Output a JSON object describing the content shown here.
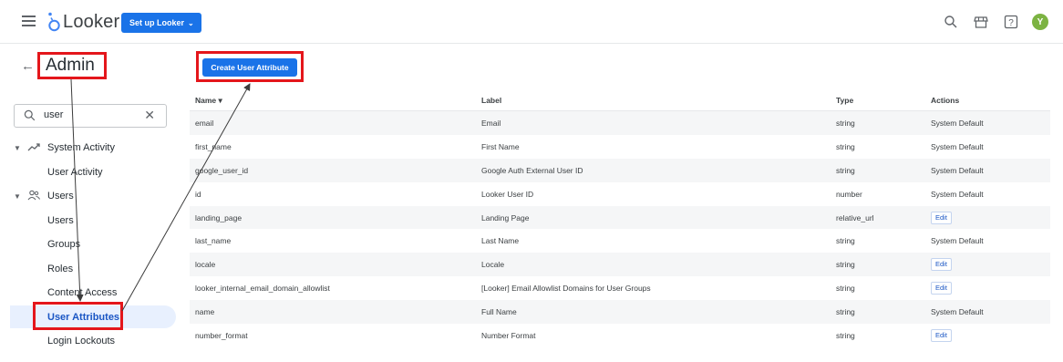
{
  "header": {
    "logo_text": "Looker",
    "setup_button_label": "Set up Looker",
    "avatar_initial": "Y",
    "icons": [
      "menu-icon",
      "search-icon",
      "marketplace-icon",
      "help-icon"
    ]
  },
  "sidebar": {
    "title": "Admin",
    "search": {
      "value": "user"
    },
    "groups": [
      {
        "label": "System Activity",
        "icon": "trend-icon",
        "items": [
          "User Activity"
        ]
      },
      {
        "label": "Users",
        "icon": "people-icon",
        "items": [
          "Users",
          "Groups",
          "Roles",
          "Content Access",
          "User Attributes",
          "Login Lockouts"
        ]
      }
    ],
    "active_item": "User Attributes"
  },
  "main": {
    "create_button_label": "Create User Attribute",
    "table": {
      "headers": [
        "Name",
        "Label",
        "Type",
        "Actions"
      ],
      "sorted_by": "Name",
      "rows": [
        {
          "name": "email",
          "label": "Email",
          "type": "string",
          "action": "System Default"
        },
        {
          "name": "first_name",
          "label": "First Name",
          "type": "string",
          "action": "System Default"
        },
        {
          "name": "google_user_id",
          "label": "Google Auth External User ID",
          "type": "string",
          "action": "System Default"
        },
        {
          "name": "id",
          "label": "Looker User ID",
          "type": "number",
          "action": "System Default"
        },
        {
          "name": "landing_page",
          "label": "Landing Page",
          "type": "relative_url",
          "action": "Edit"
        },
        {
          "name": "last_name",
          "label": "Last Name",
          "type": "string",
          "action": "System Default"
        },
        {
          "name": "locale",
          "label": "Locale",
          "type": "string",
          "action": "Edit"
        },
        {
          "name": "looker_internal_email_domain_allowlist",
          "label": "[Looker] Email Allowlist Domains for User Groups",
          "type": "string",
          "action": "Edit"
        },
        {
          "name": "name",
          "label": "Full Name",
          "type": "string",
          "action": "System Default"
        },
        {
          "name": "number_format",
          "label": "Number Format",
          "type": "string",
          "action": "Edit"
        }
      ]
    }
  },
  "colors": {
    "accent": "#1a73e8",
    "annotation_red": "#e4161b",
    "avatar": "#7cb342",
    "active_nav_bg": "#e8f0fe"
  }
}
